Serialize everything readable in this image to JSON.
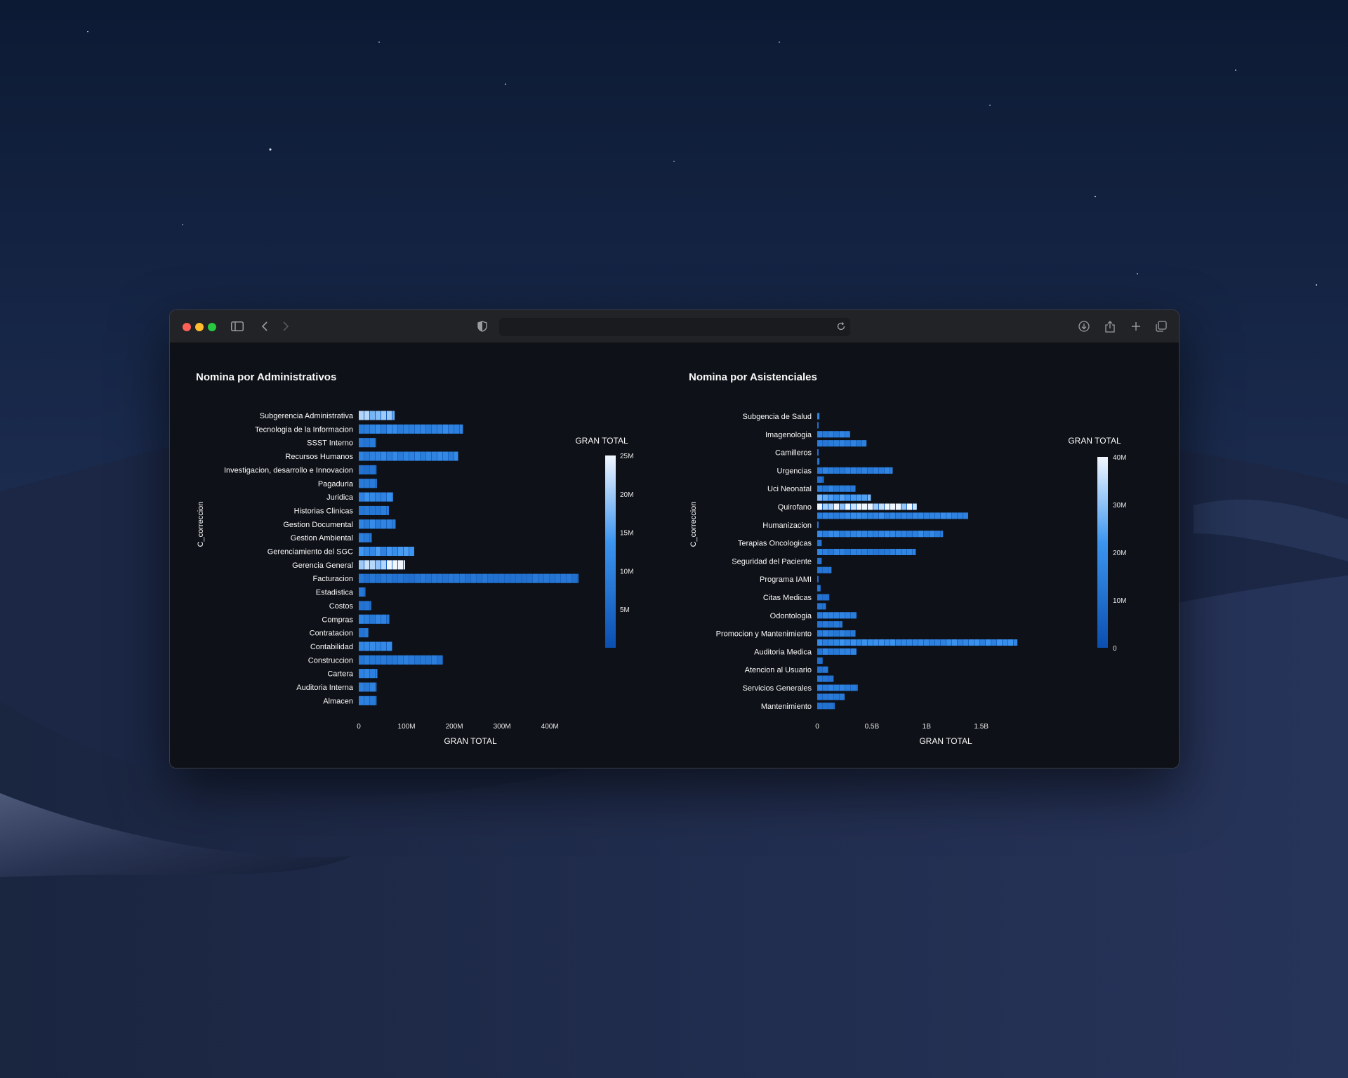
{
  "browser": {
    "address_text": "",
    "icons": [
      "sidebar-icon",
      "back-icon",
      "forward-icon",
      "shield-icon",
      "reload-icon",
      "download-icon",
      "share-icon",
      "new-tab-icon",
      "tabs-overview-icon"
    ]
  },
  "chart_data": [
    {
      "type": "bar",
      "orientation": "horizontal",
      "title": "Nomina por Administrativos",
      "xlabel": "GRAN TOTAL",
      "ylabel": "C_correccion",
      "xlim": [
        0,
        460
      ],
      "x_ticks": [
        {
          "value": 0,
          "label": "0"
        },
        {
          "value": 100,
          "label": "100M"
        },
        {
          "value": 200,
          "label": "200M"
        },
        {
          "value": 300,
          "label": "300M"
        },
        {
          "value": 400,
          "label": "400M"
        }
      ],
      "unit": "millions",
      "categories": [
        "Subgerencia Administrativa",
        "Tecnologia de la Informacion",
        "SSST Interno",
        "Recursos Humanos",
        "Investigacion, desarrollo e Innovacion",
        "Pagaduria",
        "Juridica",
        "Historias Clinicas",
        "Gestion Documental",
        "Gestion Ambiental",
        "Gerenciamiento del SGC",
        "Gerencia General",
        "Facturacion",
        "Estadistica",
        "Costos",
        "Compras",
        "Contratacion",
        "Contabilidad",
        "Construccion",
        "Cartera",
        "Auditoria Interna",
        "Almacen"
      ],
      "values": [
        75,
        218,
        36,
        208,
        37,
        38,
        72,
        63,
        77,
        27,
        116,
        97,
        460,
        14,
        26,
        64,
        20,
        70,
        176,
        39,
        37,
        37
      ],
      "color_scale": {
        "title": "GRAN TOTAL",
        "range": [
          0,
          25
        ],
        "ticks": [
          {
            "value": 5,
            "label": "5M"
          },
          {
            "value": 10,
            "label": "10M"
          },
          {
            "value": 15,
            "label": "15M"
          },
          {
            "value": 20,
            "label": "20M"
          },
          {
            "value": 25,
            "label": "25M"
          }
        ],
        "colors": [
          "#0b4fb0",
          "#3c95f0",
          "#f2f7ff"
        ]
      },
      "segment_intensity": [
        0.75,
        0.35,
        0.25,
        0.35,
        0.2,
        0.25,
        0.4,
        0.25,
        0.35,
        0.25,
        0.45,
        1.0,
        0.2,
        0.2,
        0.2,
        0.3,
        0.2,
        0.35,
        0.25,
        0.3,
        0.3,
        0.3
      ],
      "grid": false,
      "legend": "right"
    },
    {
      "type": "bar",
      "orientation": "horizontal",
      "title": "Nomina por Asistenciales",
      "xlabel": "GRAN TOTAL",
      "ylabel": "C_correccion",
      "xlim": [
        0,
        1.9
      ],
      "x_ticks": [
        {
          "value": 0,
          "label": "0"
        },
        {
          "value": 0.5,
          "label": "0.5B"
        },
        {
          "value": 1,
          "label": "1B"
        },
        {
          "value": 1.5,
          "label": "1.5B"
        }
      ],
      "unit": "billions",
      "categories": [
        "Subgencia de Salud",
        "Imagenologia",
        "Camilleros",
        "Urgencias",
        "Uci Neonatal",
        "Quirofano",
        "Humanizacion",
        "Terapias Oncologicas",
        "Seguridad del Paciente",
        "Programa IAMI",
        "Citas Medicas",
        "Odontologia",
        "Promocion y Mantenimiento",
        "Auditoria Medica",
        "Atencion al Usuario",
        "Servicios Generales",
        "Mantenimiento"
      ],
      "rows": [
        0.02,
        0.01,
        0.3,
        0.45,
        0.01,
        0.02,
        0.69,
        0.06,
        0.35,
        0.49,
        0.91,
        1.38,
        0.01,
        1.15,
        0.04,
        0.9,
        0.04,
        0.13,
        0.01,
        0.03,
        0.11,
        0.08,
        0.36,
        0.23,
        0.35,
        1.83,
        0.36,
        0.05,
        0.1,
        0.15,
        0.37,
        0.25,
        0.16
      ],
      "color_scale": {
        "title": "GRAN TOTAL",
        "range": [
          0,
          40
        ],
        "ticks": [
          {
            "value": 0,
            "label": "0"
          },
          {
            "value": 10,
            "label": "10M"
          },
          {
            "value": 20,
            "label": "20M"
          },
          {
            "value": 30,
            "label": "30M"
          },
          {
            "value": 40,
            "label": "40M"
          }
        ],
        "colors": [
          "#0b4fb0",
          "#3c95f0",
          "#f2f7ff"
        ]
      },
      "segment_intensity": [
        0.3,
        0.2,
        0.3,
        0.3,
        0.2,
        0.2,
        0.3,
        0.2,
        0.3,
        0.6,
        1.0,
        0.35,
        0.2,
        0.35,
        0.2,
        0.3,
        0.2,
        0.2,
        0.2,
        0.2,
        0.2,
        0.2,
        0.3,
        0.25,
        0.3,
        0.4,
        0.3,
        0.2,
        0.2,
        0.2,
        0.3,
        0.25,
        0.2
      ],
      "grid": false,
      "legend": "right"
    }
  ]
}
